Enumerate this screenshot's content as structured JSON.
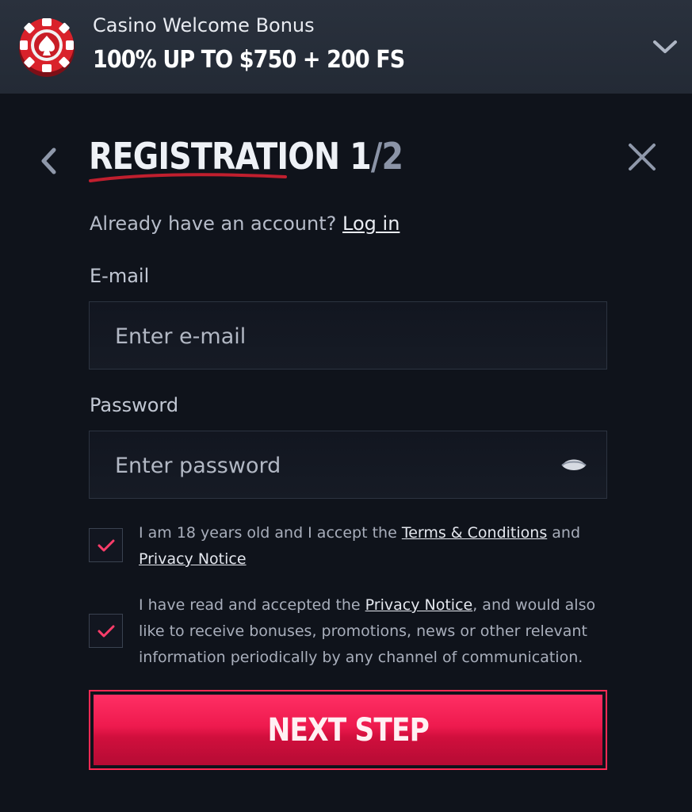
{
  "banner": {
    "title": "Casino Welcome Bonus",
    "offer": "100% UP TO $750 + 200 FS"
  },
  "header": {
    "title_main": "REGISTRATION 1",
    "title_slash": "/2"
  },
  "account": {
    "prompt": "Already have an account?",
    "login_link": "Log in"
  },
  "email": {
    "label": "E-mail",
    "placeholder": "Enter e-mail",
    "value": ""
  },
  "password": {
    "label": "Password",
    "placeholder": "Enter password",
    "value": ""
  },
  "consent_age": {
    "checked": true,
    "text_1": "I am 18 years old and I accept the ",
    "terms_link": "Terms & Conditions",
    "text_2": " and ",
    "privacy_link": "Privacy Notice"
  },
  "consent_marketing": {
    "checked": true,
    "text_1": "I have read and accepted the ",
    "privacy_link": "Privacy Notice",
    "text_2": ", and would also like to receive bonuses, promotions, news or other relevant information periodically by any channel of communication."
  },
  "submit": {
    "label": "NEXT STEP"
  },
  "colors": {
    "background": "#0f131b",
    "banner": "#262d38",
    "accent": "#ee1a4e",
    "check": "#ff3d6a"
  }
}
